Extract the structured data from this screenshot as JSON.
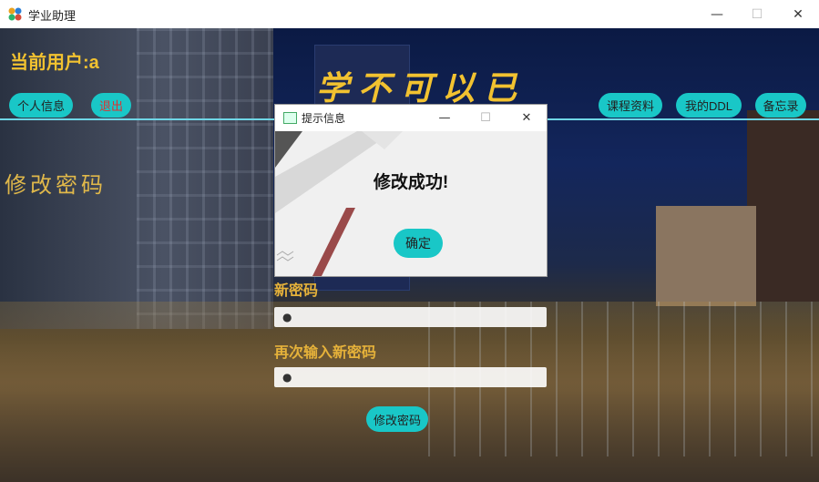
{
  "window": {
    "title": "学业助理",
    "minimize": "—",
    "maximize": "☐",
    "close": "✕"
  },
  "header": {
    "user_label": "当前用户:a",
    "banner": "学不可以已"
  },
  "nav_left": [
    {
      "label": "个人信息"
    },
    {
      "label": "退出",
      "color": "#e03030"
    }
  ],
  "nav_right": [
    {
      "label": "课程资料"
    },
    {
      "label": "我的DDL"
    },
    {
      "label": "备忘录"
    }
  ],
  "section": {
    "title": "修改密码"
  },
  "form": {
    "new_password_label": "新密码",
    "new_password_value": "●",
    "confirm_password_label": "再次输入新密码",
    "confirm_password_value": "●",
    "submit_label": "修改密码"
  },
  "dialog": {
    "title": "提示信息",
    "message": "修改成功!",
    "ok_label": "确定",
    "minimize": "—",
    "maximize": "☐",
    "close": "✕"
  },
  "colors": {
    "accent": "#19c7c7",
    "gold": "#f2c230",
    "line": "#6fd6e6"
  }
}
